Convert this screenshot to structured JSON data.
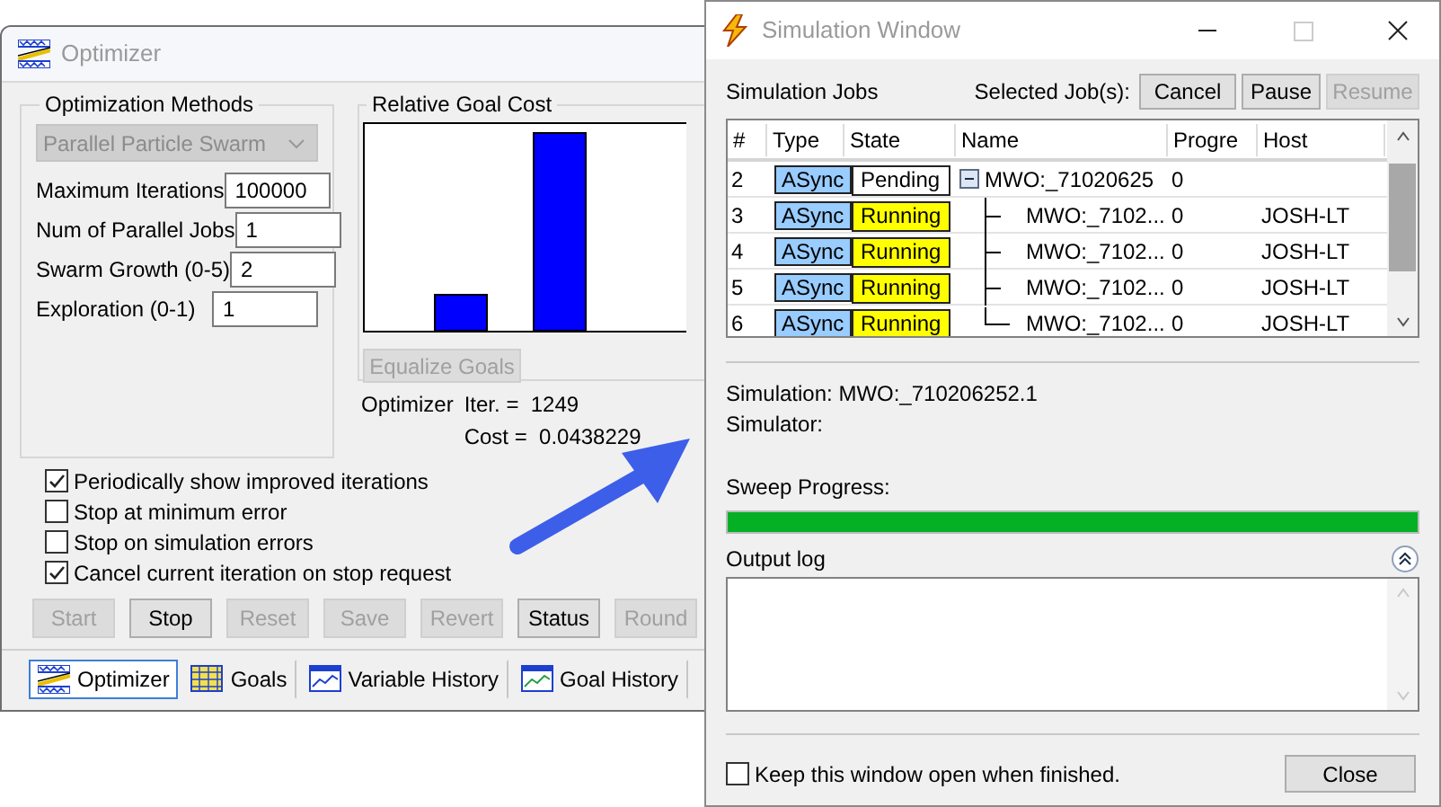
{
  "optimizer": {
    "title": "Optimizer",
    "methods": {
      "legend": "Optimization Methods",
      "method": "Parallel Particle Swarm",
      "method_disabled": true,
      "fields": [
        {
          "label": "Maximum Iterations",
          "value": "100000"
        },
        {
          "label": "Num of Parallel Jobs",
          "value": "1"
        },
        {
          "label": "Swarm Growth (0-5)",
          "value": "2"
        },
        {
          "label": "Exploration (0-1)",
          "value": "1"
        }
      ]
    },
    "goal_cost": {
      "legend": "Relative Goal Cost",
      "equalize": {
        "label": "Equalize Goals",
        "disabled": true
      }
    },
    "status": {
      "label": "Optimizer",
      "iter": "Iter. =  1249",
      "cost": "Cost =  0.0438229"
    },
    "options": [
      {
        "label": "Periodically show improved iterations",
        "checked": true
      },
      {
        "label": "Stop at minimum error",
        "checked": false
      },
      {
        "label": "Stop on simulation errors",
        "checked": false
      },
      {
        "label": "Cancel current iteration on stop request",
        "checked": true
      }
    ],
    "buttons": [
      {
        "label": "Start",
        "disabled": true
      },
      {
        "label": "Stop",
        "disabled": false
      },
      {
        "label": "Reset",
        "disabled": true
      },
      {
        "label": "Save",
        "disabled": true
      },
      {
        "label": "Revert",
        "disabled": true
      },
      {
        "label": "Status",
        "disabled": false
      },
      {
        "label": "Round",
        "disabled": true
      }
    ],
    "tabs": [
      {
        "label": "Optimizer",
        "selected": true
      },
      {
        "label": "Goals",
        "selected": false
      },
      {
        "label": "Variable History",
        "selected": false
      },
      {
        "label": "Goal History",
        "selected": false
      }
    ]
  },
  "simulation": {
    "title": "Simulation Window",
    "jobs_label": "Simulation Jobs",
    "selected_label": "Selected Job(s):",
    "job_buttons": [
      {
        "label": "Cancel",
        "disabled": false
      },
      {
        "label": "Pause",
        "disabled": false
      },
      {
        "label": "Resume",
        "disabled": true
      }
    ],
    "columns": [
      "#",
      "Type",
      "State",
      "Name",
      "Progre",
      "Host"
    ],
    "jobs": [
      {
        "num": "2",
        "type": "ASync",
        "state": {
          "label": "Pending",
          "color": "#ffffff"
        },
        "name": "MWO:_71020625",
        "progress": "0",
        "expanded": true,
        "children": [
          {
            "num": "3",
            "type": "ASync",
            "state": {
              "label": "Running",
              "color": "#ffff00"
            },
            "name": "MWO:_7102...",
            "progress": "0",
            "host": "JOSH-LT"
          },
          {
            "num": "4",
            "type": "ASync",
            "state": {
              "label": "Running",
              "color": "#ffff00"
            },
            "name": "MWO:_7102...",
            "progress": "0",
            "host": "JOSH-LT"
          },
          {
            "num": "5",
            "type": "ASync",
            "state": {
              "label": "Running",
              "color": "#ffff00"
            },
            "name": "MWO:_7102...",
            "progress": "0",
            "host": "JOSH-LT"
          },
          {
            "num": "6",
            "type": "ASync",
            "state": {
              "label": "Running",
              "color": "#ffff00"
            },
            "name": "MWO:_7102...",
            "progress": "0",
            "host": "JOSH-LT"
          }
        ]
      }
    ],
    "simulation_line": "Simulation: MWO:_710206252.1",
    "simulator_line": "Simulator:",
    "sweep_label": "Sweep Progress:",
    "sweep": {
      "level": 1
    },
    "log_label": "Output log",
    "keep_open": {
      "label": "Keep this window open when finished.",
      "checked": false
    },
    "close": "Close"
  }
}
